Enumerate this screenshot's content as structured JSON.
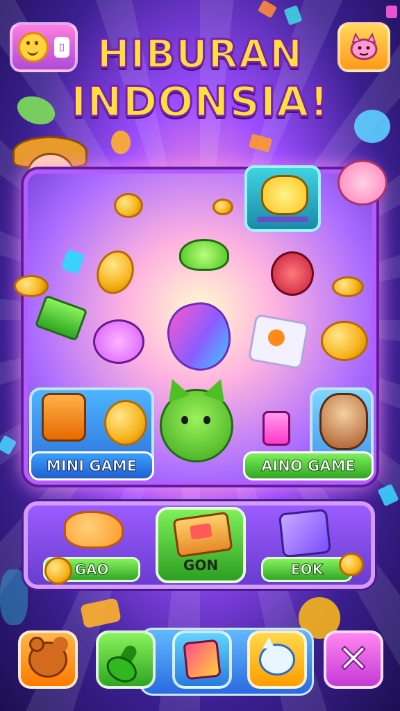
{
  "title": {
    "line1": "HIBURAN",
    "line2": "INDONSIA!"
  },
  "top_bar": {
    "profile_badge": "▯"
  },
  "panel": {
    "mini_game_label": "MINI GAME",
    "aino_game_label": "AINO GAME"
  },
  "selector": {
    "left_label": "GAO",
    "center_label": "GON",
    "right_label": "EOK"
  },
  "colors": {
    "title_fill": "#ffe03a",
    "title_outline": "#7a1fb0",
    "panel_border": "#b65cff",
    "mini_button": "#3aa0ff",
    "green_button": "#32a625"
  },
  "icons": {
    "profile": "smiley-icon",
    "pet": "pet-icon",
    "nav": [
      "bear-icon",
      "guitar-icon",
      "heart-card-icon",
      "cat-face-icon",
      "close-icon"
    ]
  }
}
